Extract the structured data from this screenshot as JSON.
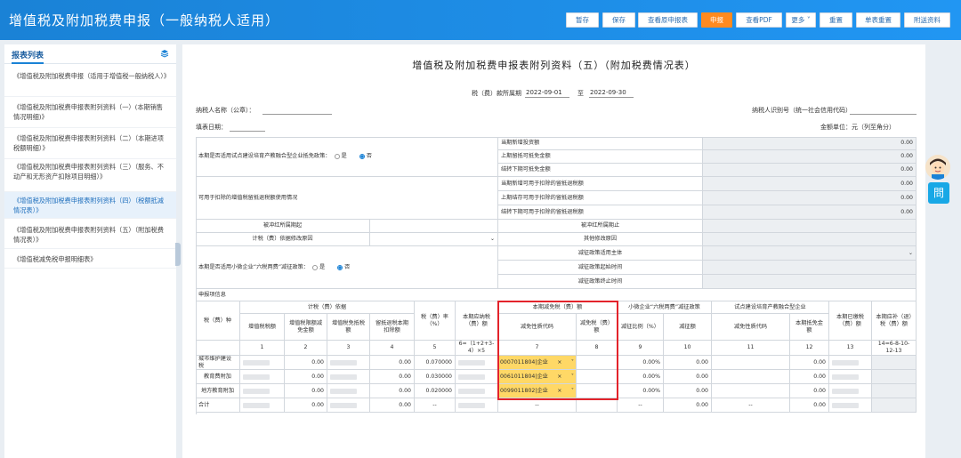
{
  "app": {
    "title": "增值税及附加税费申报（一般纳税人适用）",
    "buttons": [
      "暂存",
      "保存",
      "查看原申报表",
      "申报",
      "查看PDF",
      "更多",
      "重置",
      "单表重置",
      "附送资料"
    ],
    "active_button": "申报",
    "accent": "#1a82d6",
    "highlight": "#ff8a1f"
  },
  "sidebar": {
    "title": "报表列表",
    "items": [
      "《增值税及附加税费申报（适用于增值税一般纳税人）》",
      "《增值税及附加税费申报表附列资料（一）(本期销售情况明细)》",
      "《增值税及附加税费申报表附列资料（二）（本期进项税额明细）》",
      "《增值税及附加税费申报表附列资料（三）（服务、不动产和无形资产扣除项目明细）》",
      "《增值税及附加税费申报表附列资料（四）（税额抵减情况表）》",
      "《增值税及附加税费申报表附列资料（五）（附加税费情况表）》",
      "《增值税减免税申报明细表》"
    ],
    "selected_index": 4
  },
  "form": {
    "title": "增值税及附加税费申报表附列资料（五）（附加税费情况表）",
    "period_label": "税（费）款所属期",
    "period_start": "2022-09-01",
    "period_to": "至",
    "period_end": "2022-09-30",
    "taxpayer_name_label": "纳税人名称（公章）：",
    "taxpayer_id_label": "纳税人识别号（统一社会信用代码）",
    "fill_date_label": "填表日期：",
    "unit_label": "金额单位：元（列至角分）",
    "section1": {
      "question": "本期是否适用试点建设培育产教融合型企业抵免政策：",
      "opt_yes": "是",
      "opt_no": "否",
      "selected": "否",
      "rows": [
        {
          "label": "当期新增投资额",
          "value": "0.00"
        },
        {
          "label": "上期留抵可抵免金额",
          "value": "0.00"
        },
        {
          "label": "结转下期可抵免金额",
          "value": "0.00"
        }
      ]
    },
    "section2": {
      "question": "可用于扣除的增值税留抵退税额使用情况",
      "rows": [
        {
          "label": "当期新增可用于扣除的留抵退税额",
          "value": "0.00"
        },
        {
          "label": "上期结存可用于扣除的留抵退税额",
          "value": "0.00"
        },
        {
          "label": "结转下期可用于扣除的留抵退税额",
          "value": "0.00"
        }
      ]
    },
    "section3": {
      "left1": "被冲红所属期起",
      "right1": "被冲红所属期止",
      "left2": "计税（费）依据修改原因",
      "right2": "其他修改原因",
      "question": "本期是否适用小微企业“六税两费”减征政策：",
      "opt_yes": "是",
      "opt_no": "否",
      "selected": "否",
      "rows": [
        "减征政策适用主体",
        "减征政策起始时间",
        "减征政策终止时间"
      ]
    },
    "table": {
      "section_label": "申报项信息",
      "h_tax_type": "税（费）种",
      "h_basis": "计税（费）依据",
      "h_basis_cols": [
        "增值税税额",
        "增值税限额减免金额",
        "增值税免抵税额",
        "留抵退税本期扣除额"
      ],
      "h_rate": "税（费）率（%）",
      "h_payable": "本期应纳税（费）额",
      "h_reduction": "本期减免税（费）额",
      "h_reduction_cols": [
        "减免性质代码",
        "减免税（费）额"
      ],
      "h_small": "小微企业“六税两费”减征政策",
      "h_small_cols": [
        "减征比例（%）",
        "减征额"
      ],
      "h_pilot": "试点建设培育产教融合型企业",
      "h_pilot_cols": [
        "减免性质代码",
        "本期抵免金额"
      ],
      "h_paid": "本期已缴税（费）额",
      "h_due": "本期应补（退）税（费）额",
      "col_numbers": [
        "1",
        "2",
        "3",
        "4",
        "5",
        "6=（1+2+3-4）×5",
        "7",
        "8",
        "9",
        "10",
        "11",
        "12",
        "13",
        "14=6-8-10-12-13"
      ],
      "rows": [
        {
          "name": "城市维护建设税",
          "c2": "0.00",
          "c4": "0.00",
          "rate": "0.070000",
          "code": "0007011804|企业",
          "pct": "0.00%",
          "red": "0.00",
          "pilot": "0.00"
        },
        {
          "name": "教育费附加",
          "c2": "0.00",
          "c4": "0.00",
          "rate": "0.030000",
          "code": "0061011804|企业",
          "pct": "0.00%",
          "red": "0.00",
          "pilot": "0.00"
        },
        {
          "name": "地方教育附加",
          "c2": "0.00",
          "c4": "0.00",
          "rate": "0.020000",
          "code": "0099011802|企业",
          "pct": "0.00%",
          "red": "0.00",
          "pilot": "0.00"
        }
      ],
      "total": {
        "name": "合计",
        "c2": "0.00",
        "c4": "0.00",
        "rate": "--",
        "code": "--",
        "pct": "--",
        "red": "0.00",
        "pilot_code": "--",
        "pilot": "0.00"
      }
    }
  },
  "float": {
    "tag": "問"
  }
}
